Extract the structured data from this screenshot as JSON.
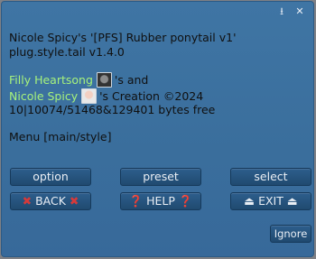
{
  "window": {
    "controls": [
      {
        "name": "download-icon",
        "glyph": "⭳"
      },
      {
        "name": "close-icon",
        "glyph": "✕"
      }
    ]
  },
  "message": {
    "line1": "Nicole Spicy's '[PFS] Rubber ponytail v1'",
    "line2": "plug.style.tail v1.4.0",
    "author1": "Filly Heartsong",
    "suffix1": "'s and",
    "author2": "Nicole Spicy",
    "suffix2": "'s Creation ©2024",
    "line5": "10|10074/51468&129401 bytes free",
    "line6": "Menu [main/style]"
  },
  "buttons": {
    "option": "option",
    "preset": "preset",
    "select": "select",
    "back": "BACK",
    "help": "HELP",
    "exit": "EXIT",
    "ignore": "Ignore"
  },
  "glyphs": {
    "x": "✖",
    "question": "❓",
    "eject": "⏏"
  },
  "colors": {
    "dialog_bg": "#3a6e9c",
    "link_green": "#a6f27c",
    "button_bg": "#204a70"
  }
}
